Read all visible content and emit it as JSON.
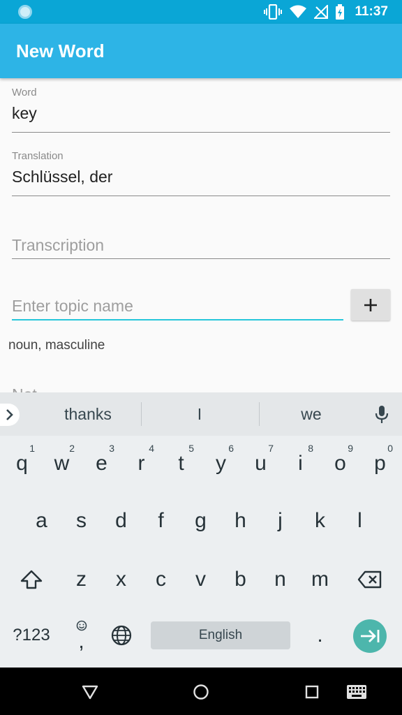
{
  "status_bar": {
    "time": "11:37"
  },
  "app_bar": {
    "title": "New Word"
  },
  "form": {
    "word": {
      "label": "Word",
      "value": "key"
    },
    "translation": {
      "label": "Translation",
      "value": "Schlüssel, der"
    },
    "transcription": {
      "placeholder": "Transcription"
    },
    "topic": {
      "placeholder": "Enter topic name",
      "add_label": "+"
    },
    "topic_text": "noun, masculine",
    "notes_peek": "Not"
  },
  "suggestions": [
    "thanks",
    "I",
    "we"
  ],
  "keyboard": {
    "row1": [
      {
        "k": "q",
        "h": "1"
      },
      {
        "k": "w",
        "h": "2"
      },
      {
        "k": "e",
        "h": "3"
      },
      {
        "k": "r",
        "h": "4"
      },
      {
        "k": "t",
        "h": "5"
      },
      {
        "k": "y",
        "h": "6"
      },
      {
        "k": "u",
        "h": "7"
      },
      {
        "k": "i",
        "h": "8"
      },
      {
        "k": "o",
        "h": "9"
      },
      {
        "k": "p",
        "h": "0"
      }
    ],
    "row2": [
      "a",
      "s",
      "d",
      "f",
      "g",
      "h",
      "j",
      "k",
      "l"
    ],
    "row3": [
      "z",
      "x",
      "c",
      "v",
      "b",
      "n",
      "m"
    ],
    "symbols_label": "?123",
    "comma_label": ",",
    "space_label": "English",
    "period_label": "."
  },
  "colors": {
    "status_bar": "#0aa6d6",
    "app_bar": "#2db4e6",
    "focus_line": "#26c6da",
    "enter_key": "#4db6ac"
  },
  "icons": {
    "status": [
      "vibrate-icon",
      "wifi-icon",
      "no-signal-icon",
      "battery-charging-icon"
    ],
    "suggest": [
      "chevron-right-icon",
      "mic-icon"
    ],
    "keyboard": [
      "shift-icon",
      "backspace-icon",
      "emoji-icon",
      "globe-icon",
      "enter-arrow-icon"
    ],
    "nav": [
      "back-icon",
      "home-icon",
      "recents-icon",
      "keyboard-switch-icon"
    ]
  }
}
